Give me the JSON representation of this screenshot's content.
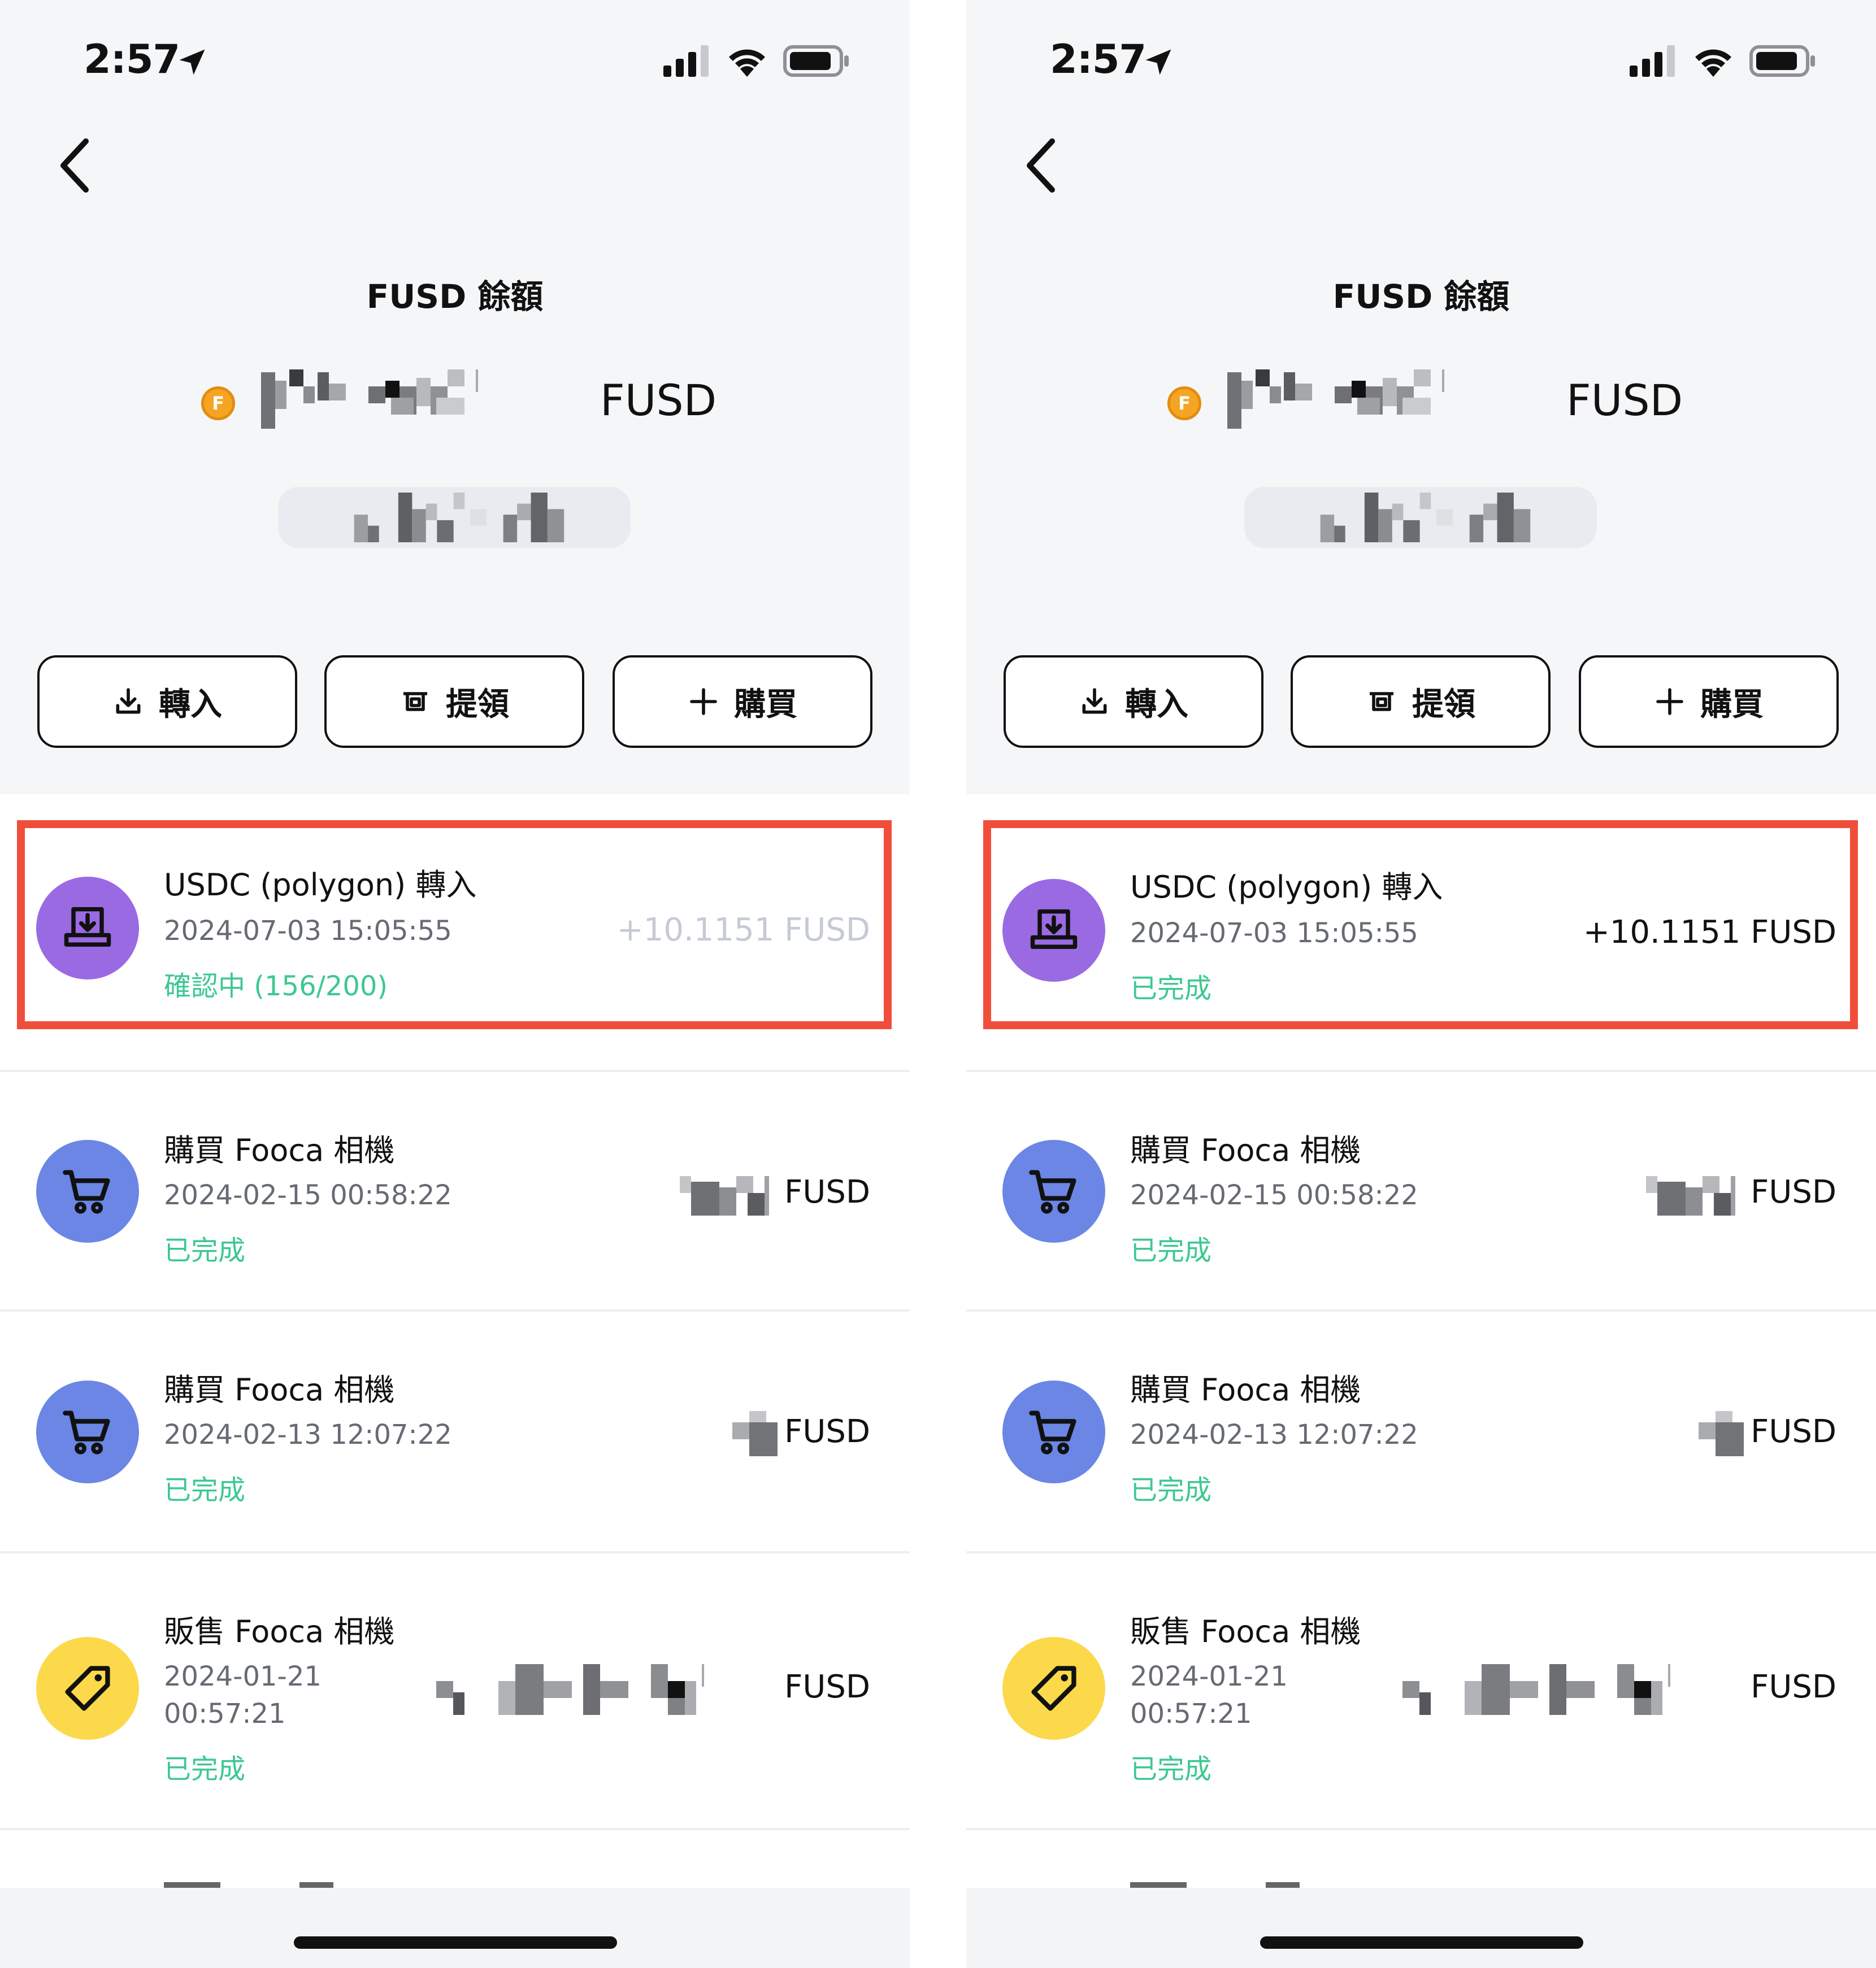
{
  "status_bar": {
    "time": "2:57"
  },
  "header": {
    "balance_label": "FUSD 餘額",
    "balance_unit": "FUSD"
  },
  "actions": {
    "transfer_in": "轉入",
    "withdraw": "提領",
    "buy": "購買"
  },
  "coin": {
    "letter": "F"
  },
  "screens": [
    {
      "transactions": [
        {
          "title": "USDC (polygon) 轉入",
          "date": "2024-07-03 15:05:55",
          "status": "確認中 (156/200)",
          "amount": "+10.1151 FUSD",
          "icon": "download-tray-icon",
          "status_color": "#3dc891"
        },
        {
          "title": "購買 Fooca 相機",
          "date": "2024-02-15 00:58:22",
          "status": "已完成",
          "amount": "FUSD",
          "icon": "cart-icon"
        },
        {
          "title": "購買 Fooca 相機",
          "date": "2024-02-13 12:07:22",
          "status": "已完成",
          "amount": "FUSD",
          "icon": "cart-icon"
        },
        {
          "title": "販售 Fooca 相機",
          "date": "2024-01-21",
          "date2": "00:57:21",
          "status": "已完成",
          "amount": "FUSD",
          "icon": "tag-icon"
        }
      ]
    },
    {
      "transactions": [
        {
          "title": "USDC (polygon) 轉入",
          "date": "2024-07-03 15:05:55",
          "status": "已完成",
          "amount": "+10.1151 FUSD",
          "icon": "download-tray-icon"
        },
        {
          "title": "購買 Fooca 相機",
          "date": "2024-02-15 00:58:22",
          "status": "已完成",
          "amount": "FUSD",
          "icon": "cart-icon"
        },
        {
          "title": "購買 Fooca 相機",
          "date": "2024-02-13 12:07:22",
          "status": "已完成",
          "amount": "FUSD",
          "icon": "cart-icon"
        },
        {
          "title": "販售 Fooca 相機",
          "date": "2024-01-21",
          "date2": "00:57:21",
          "status": "已完成",
          "amount": "FUSD",
          "icon": "tag-icon"
        }
      ]
    }
  ],
  "colors": {
    "highlight": "#f04e3a",
    "status_green": "#3dc891",
    "accent_purple": "#9a6ae3",
    "accent_blue": "#6b86e4",
    "accent_yellow": "#fbd94a"
  }
}
